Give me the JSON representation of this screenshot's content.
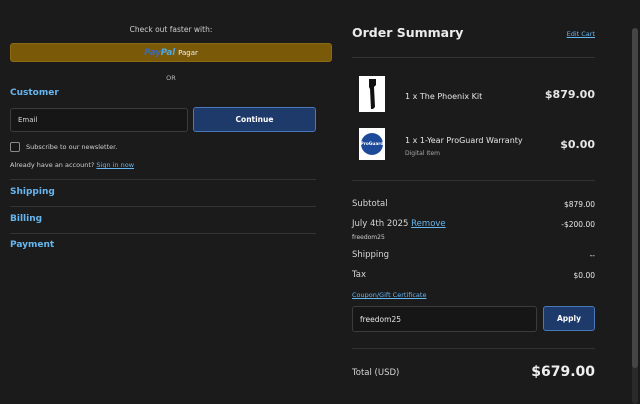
{
  "express": {
    "checkout_faster": "Check out faster with:",
    "paypal_pay": "Pay",
    "paypal_pal": "Pal",
    "paypal_label": "Pagar",
    "or": "OR"
  },
  "customer": {
    "title": "Customer",
    "email_placeholder": "Email",
    "continue_label": "Continue",
    "newsletter_label": "Subscribe to our newsletter.",
    "account_prompt": "Already have an account?",
    "signin_link": "Sign in now"
  },
  "steps": {
    "shipping": "Shipping",
    "billing": "Billing",
    "payment": "Payment"
  },
  "order_summary": {
    "title": "Order Summary",
    "edit_cart": "Edit Cart",
    "items": [
      {
        "name": "1 x The Phoenix Kit",
        "price": "$879.00",
        "thumb_icon": "kit-image"
      },
      {
        "name": "1 x 1-Year ProGuard Warranty",
        "subtitle": "Digital Item",
        "price": "$0.00",
        "thumb_icon": "proguard-logo",
        "thumb_text": "ProGuard"
      }
    ],
    "subtotal_label": "Subtotal",
    "subtotal_value": "$879.00",
    "discount_label": "July 4th 2025",
    "discount_remove": "Remove",
    "discount_code": "freedom25",
    "discount_value": "-$200.00",
    "shipping_label": "Shipping",
    "shipping_value": "--",
    "tax_label": "Tax",
    "tax_value": "$0.00",
    "coupon_link": "Coupon/Gift Certificate",
    "coupon_value": "freedom25",
    "apply_label": "Apply",
    "total_label": "Total (USD)",
    "total_value": "$679.00"
  },
  "colors": {
    "background": "#1b1b1b",
    "accent_link": "#66b6f0",
    "button_primary": "#1e3a6b",
    "paypal_button": "#7a5a09"
  }
}
